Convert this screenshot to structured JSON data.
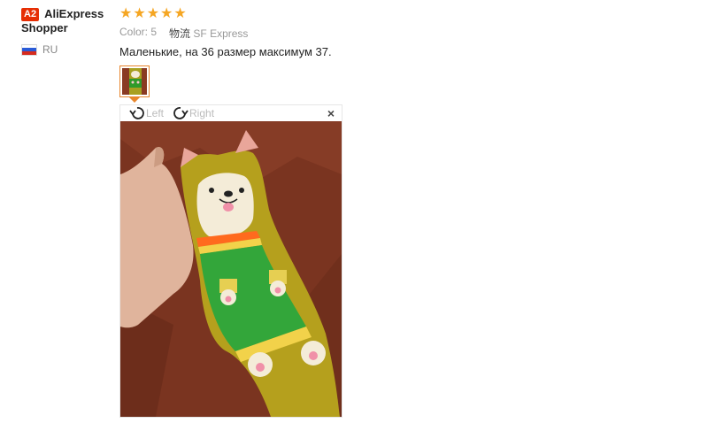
{
  "reviewer": {
    "badge": "A2",
    "name_line1": "AliExpress",
    "name_line2": "Shopper",
    "country": "RU"
  },
  "rating": {
    "stars": 5,
    "max": 5
  },
  "meta": {
    "color_label": "Color:",
    "color_value": "5",
    "shipping_label": "物流",
    "shipping_value": "SF Express"
  },
  "review_text": "Маленькие, на 36 размер максимум 37.",
  "viewer": {
    "rotate_left": "Left",
    "rotate_right": "Right",
    "close": "×"
  },
  "colors": {
    "accent": "#e8862c",
    "star": "#f5a623",
    "badge": "#e62e04"
  }
}
